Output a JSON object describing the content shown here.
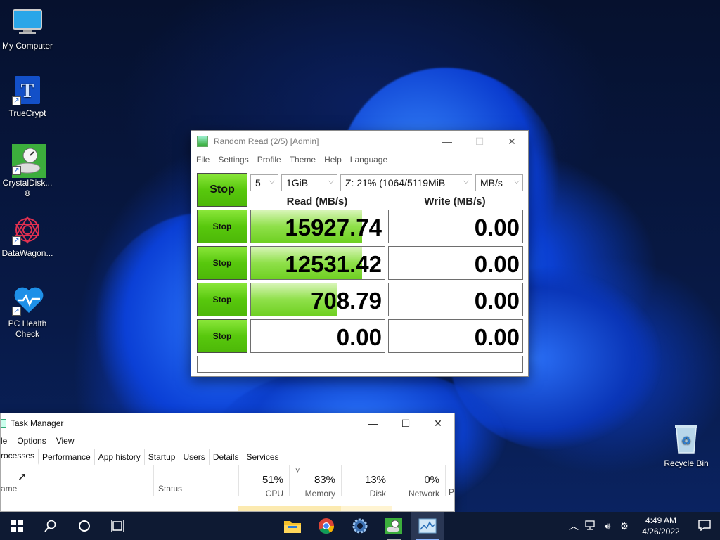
{
  "desktop": {
    "icons": [
      {
        "label": "My Computer",
        "icon": "computer-icon"
      },
      {
        "label": "TrueCrypt",
        "icon": "truecrypt-icon"
      },
      {
        "label": "CrystalDisk...\n8",
        "label_line1": "CrystalDisk...",
        "label_line2": "8",
        "icon": "crystaldisk-icon"
      },
      {
        "label": "DataWagon...",
        "icon": "datawagon-icon"
      },
      {
        "label_line1": "PC Health",
        "label_line2": "Check",
        "icon": "heart-icon"
      }
    ],
    "recycle_bin": {
      "label": "Recycle Bin"
    }
  },
  "cdm": {
    "title": "Random Read (2/5) [Admin]",
    "menu": [
      "File",
      "Settings",
      "Profile",
      "Theme",
      "Help",
      "Language"
    ],
    "main_button": "Stop",
    "count": "5",
    "size": "1GiB",
    "drive": "Z: 21% (1064/5119MiB",
    "unit": "MB/s",
    "read_header": "Read (MB/s)",
    "write_header": "Write (MB/s)",
    "rows": [
      {
        "button": "Stop",
        "read": "15927.74",
        "read_fill": 0.83,
        "write": "0.00",
        "write_fill": 0
      },
      {
        "button": "Stop",
        "read": "12531.42",
        "read_fill": 0.83,
        "write": "0.00",
        "write_fill": 0
      },
      {
        "button": "Stop",
        "read": "708.79",
        "read_fill": 0.64,
        "write": "0.00",
        "write_fill": 0
      },
      {
        "button": "Stop",
        "read": "0.00",
        "read_fill": 0,
        "write": "0.00",
        "write_fill": 0
      }
    ]
  },
  "taskmanager": {
    "title": "Task Manager",
    "menu": [
      "le",
      "Options",
      "View"
    ],
    "tabs": [
      "rocesses",
      "Performance",
      "App history",
      "Startup",
      "Users",
      "Details",
      "Services"
    ],
    "columns": {
      "name": "ame",
      "status": "Status",
      "cpu": {
        "pct": "51%",
        "label": "CPU"
      },
      "memory": {
        "pct": "83%",
        "label": "Memory"
      },
      "disk": {
        "pct": "13%",
        "label": "Disk"
      },
      "network": {
        "pct": "0%",
        "label": "Network"
      },
      "power": {
        "label": "Po"
      }
    }
  },
  "taskbar": {
    "time": "4:49 AM",
    "date": "4/26/2022"
  },
  "colors": {
    "accent_green": "#58c80d",
    "taskbar": "#0e1a33"
  }
}
